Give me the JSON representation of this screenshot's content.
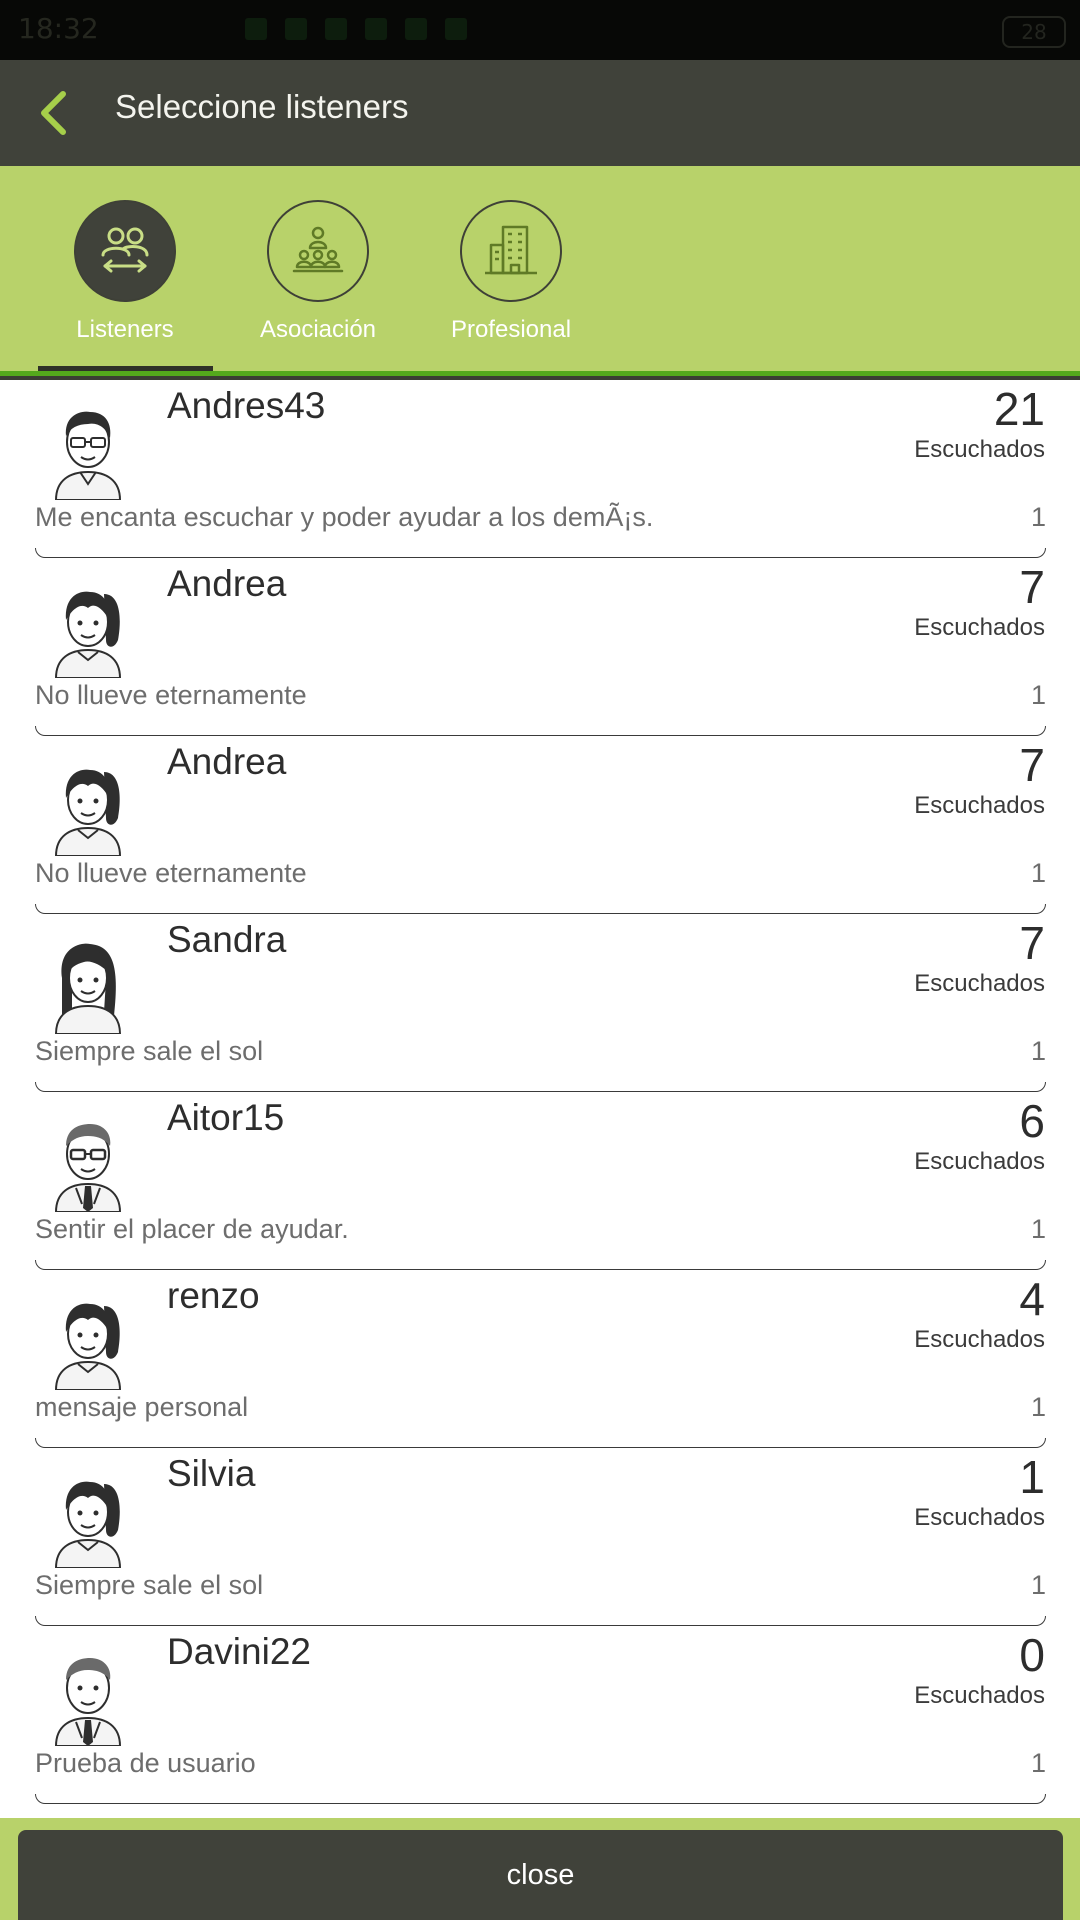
{
  "status_bar": {
    "time": "18:32",
    "battery": "28"
  },
  "header": {
    "title": "Seleccione listeners"
  },
  "tabs": [
    {
      "label": "Listeners",
      "icon": "listeners-exchange-icon",
      "active": true
    },
    {
      "label": "Asociación",
      "icon": "association-group-icon",
      "active": false
    },
    {
      "label": "Profesional",
      "icon": "building-icon",
      "active": false
    }
  ],
  "listeners": [
    {
      "name": "Andres43",
      "count": "21",
      "count_label": "Escuchados",
      "message": "Me encanta escuchar y poder ayudar a los demÃ¡s.",
      "number": "1",
      "avatar": "man-glasses"
    },
    {
      "name": "Andrea",
      "count": "7",
      "count_label": "Escuchados",
      "message": "No llueve eternamente",
      "number": "1",
      "avatar": "woman-ponytail"
    },
    {
      "name": "Andrea",
      "count": "7",
      "count_label": "Escuchados",
      "message": "No llueve eternamente",
      "number": "1",
      "avatar": "woman-ponytail"
    },
    {
      "name": "Sandra",
      "count": "7",
      "count_label": "Escuchados",
      "message": "Siempre sale el sol",
      "number": "1",
      "avatar": "woman-long-hair"
    },
    {
      "name": "Aitor15",
      "count": "6",
      "count_label": "Escuchados",
      "message": "Sentir el placer de ayudar.",
      "number": "1",
      "avatar": "man-glasses-tie"
    },
    {
      "name": "renzo",
      "count": "4",
      "count_label": "Escuchados",
      "message": "mensaje personal",
      "number": "1",
      "avatar": "woman-ponytail"
    },
    {
      "name": "Silvia",
      "count": "1",
      "count_label": "Escuchados",
      "message": "Siempre sale el sol",
      "number": "1",
      "avatar": "woman-ponytail"
    },
    {
      "name": "Davini22",
      "count": "0",
      "count_label": "Escuchados",
      "message": "Prueba de usuario",
      "number": "1",
      "avatar": "man-tie"
    }
  ],
  "footer": {
    "close_label": "close"
  },
  "colors": {
    "header": "#40423a",
    "accent": "#b8d26a",
    "accent_line": "#54a81c"
  }
}
